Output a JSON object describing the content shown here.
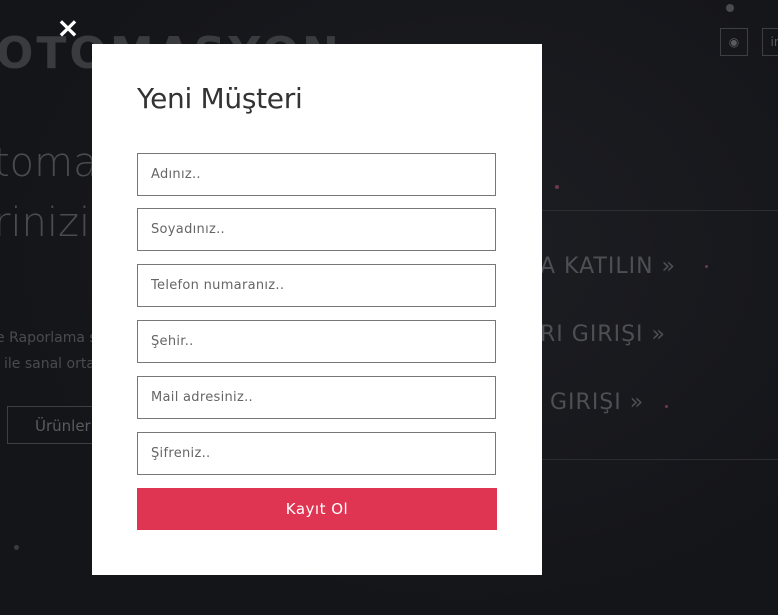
{
  "background": {
    "logo": "OTOMASYON",
    "hero_line1": "toma",
    "hero_line2": "rinizi",
    "desc_line1": "e Raporlama s",
    "desc_line2": "ile sanal orta",
    "products_button": "Ürünler",
    "menu": [
      "A KATILIN »",
      "RI GIRIŞI »",
      "GIRIŞI »"
    ],
    "social_icons": [
      "github-icon",
      "linkedin-icon"
    ]
  },
  "modal": {
    "close_symbol": "×",
    "title": "Yeni Müşteri",
    "fields": {
      "name": "Adınız..",
      "surname": "Soyadınız..",
      "phone": "Telefon numaranız..",
      "city": "Şehir..",
      "email": "Mail adresiniz..",
      "password": "Şifreniz.."
    },
    "submit_label": "Kayıt Ol"
  },
  "colors": {
    "accent": "#e03552",
    "overlay_bg": "#15161a",
    "modal_bg": "#ffffff"
  }
}
